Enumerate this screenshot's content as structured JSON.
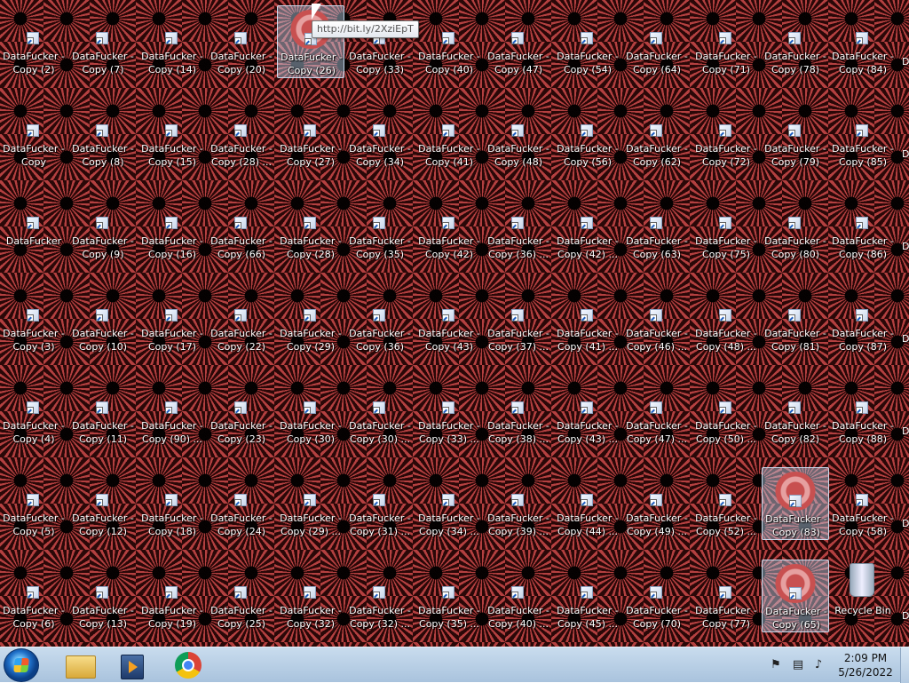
{
  "desktop": {
    "icon_columns": [
      [
        "DataFucker - Copy (2)",
        "DataFucker - Copy",
        "DataFucker",
        "DataFucker - Copy (3)",
        "DataFucker - Copy (4)",
        "DataFucker - Copy (5)",
        "DataFucker - Copy (6)"
      ],
      [
        "DataFucker - Copy (7)",
        "DataFucker - Copy (8)",
        "DataFucker - Copy (9)",
        "DataFucker - Copy (10)",
        "DataFucker - Copy (11)",
        "DataFucker - Copy (12)",
        "DataFucker - Copy (13)"
      ],
      [
        "DataFucker - Copy (14)",
        "DataFucker - Copy (15)",
        "DataFucker - Copy (16)",
        "DataFucker - Copy (17)",
        "DataFucker - Copy (90) ...",
        "DataFucker - Copy (18)",
        "DataFucker - Copy (19)"
      ],
      [
        "DataFucker - Copy (20)",
        "DataFucker - Copy (28) ...",
        "DataFucker - Copy (66)",
        "DataFucker - Copy (22)",
        "DataFucker - Copy (23)",
        "DataFucker - Copy (24)",
        "DataFucker - Copy (25)"
      ],
      [
        "DataFucker - Copy (26)",
        "DataFucker - Copy (27)",
        "DataFucker - Copy (28)",
        "DataFucker - Copy (29)",
        "DataFucker - Copy (30)",
        "DataFucker - Copy (29) ...",
        "DataFucker - Copy (32)"
      ],
      [
        "DataFucker - Copy (33)",
        "DataFucker - Copy (34)",
        "DataFucker - Copy (35)",
        "DataFucker - Copy (36)",
        "DataFucker - Copy (30) ...",
        "DataFucker - Copy (31) ...",
        "DataFucker - Copy (32) ..."
      ],
      [
        "DataFucker - Copy (40)",
        "DataFucker - Copy (41)",
        "DataFucker - Copy (42)",
        "DataFucker - Copy (43)",
        "DataFucker - Copy (33) ...",
        "DataFucker - Copy (34) ...",
        "DataFucker - Copy (35) ..."
      ],
      [
        "DataFucker - Copy (47)",
        "DataFucker - Copy (48)",
        "DataFucker - Copy (36) ...",
        "DataFucker - Copy (37) ...",
        "DataFucker - Copy (38) ...",
        "DataFucker - Copy (39) ...",
        "DataFucker - Copy (40) ..."
      ],
      [
        "DataFucker - Copy (54)",
        "DataFucker - Copy (56)",
        "DataFucker - Copy (42) ...",
        "DataFucker - Copy (41) ...",
        "DataFucker - Copy (43) ...",
        "DataFucker - Copy (44) ...",
        "DataFucker - Copy (45) ..."
      ],
      [
        "DataFucker - Copy (64)",
        "DataFucker - Copy (62)",
        "DataFucker - Copy (63)",
        "DataFucker - Copy (46) ...",
        "DataFucker - Copy (47) ...",
        "DataFucker - Copy (49) ...",
        "DataFucker - Copy (70)"
      ],
      [
        "DataFucker - Copy (71)",
        "DataFucker - Copy (72)",
        "DataFucker - Copy (75)",
        "DataFucker - Copy (48) ...",
        "DataFucker - Copy (50) ...",
        "DataFucker - Copy (52) ...",
        "DataFucker - Copy (77)"
      ],
      [
        "DataFucker - Copy (78)",
        "DataFucker - Copy (79)",
        "DataFucker - Copy (80)",
        "DataFucker - Copy (81)",
        "DataFucker - Copy (82)",
        "DataFucker - Copy (83)",
        "DataFucker - Copy (65)"
      ],
      [
        "DataFucker - Copy (84)",
        "DataFucker - Copy (85)",
        "DataFucker - Copy (86)",
        "DataFucker - Copy (87)",
        "DataFucker - Copy (88)",
        "DataFucker - Copy (58)",
        "Recycle Bin"
      ]
    ],
    "selected_icons": [
      "DataFucker - Copy (26)",
      "DataFucker - Copy (83)",
      "DataFucker - Copy (65)"
    ],
    "tooltip": "http://bit.ly/2XziEpT",
    "edge_label": "D",
    "wallpaper_color": "#b44040"
  },
  "taskbar": {
    "pinned": [
      {
        "name": "Windows Explorer",
        "icon": "folder-icon"
      },
      {
        "name": "Windows Media Player",
        "icon": "media-player-icon"
      },
      {
        "name": "Google Chrome",
        "icon": "chrome-icon"
      }
    ],
    "tray_icons": [
      "action-center-flag-icon",
      "network-icon",
      "volume-icon"
    ],
    "clock": {
      "time": "2:09 PM",
      "date": "5/26/2022"
    }
  }
}
